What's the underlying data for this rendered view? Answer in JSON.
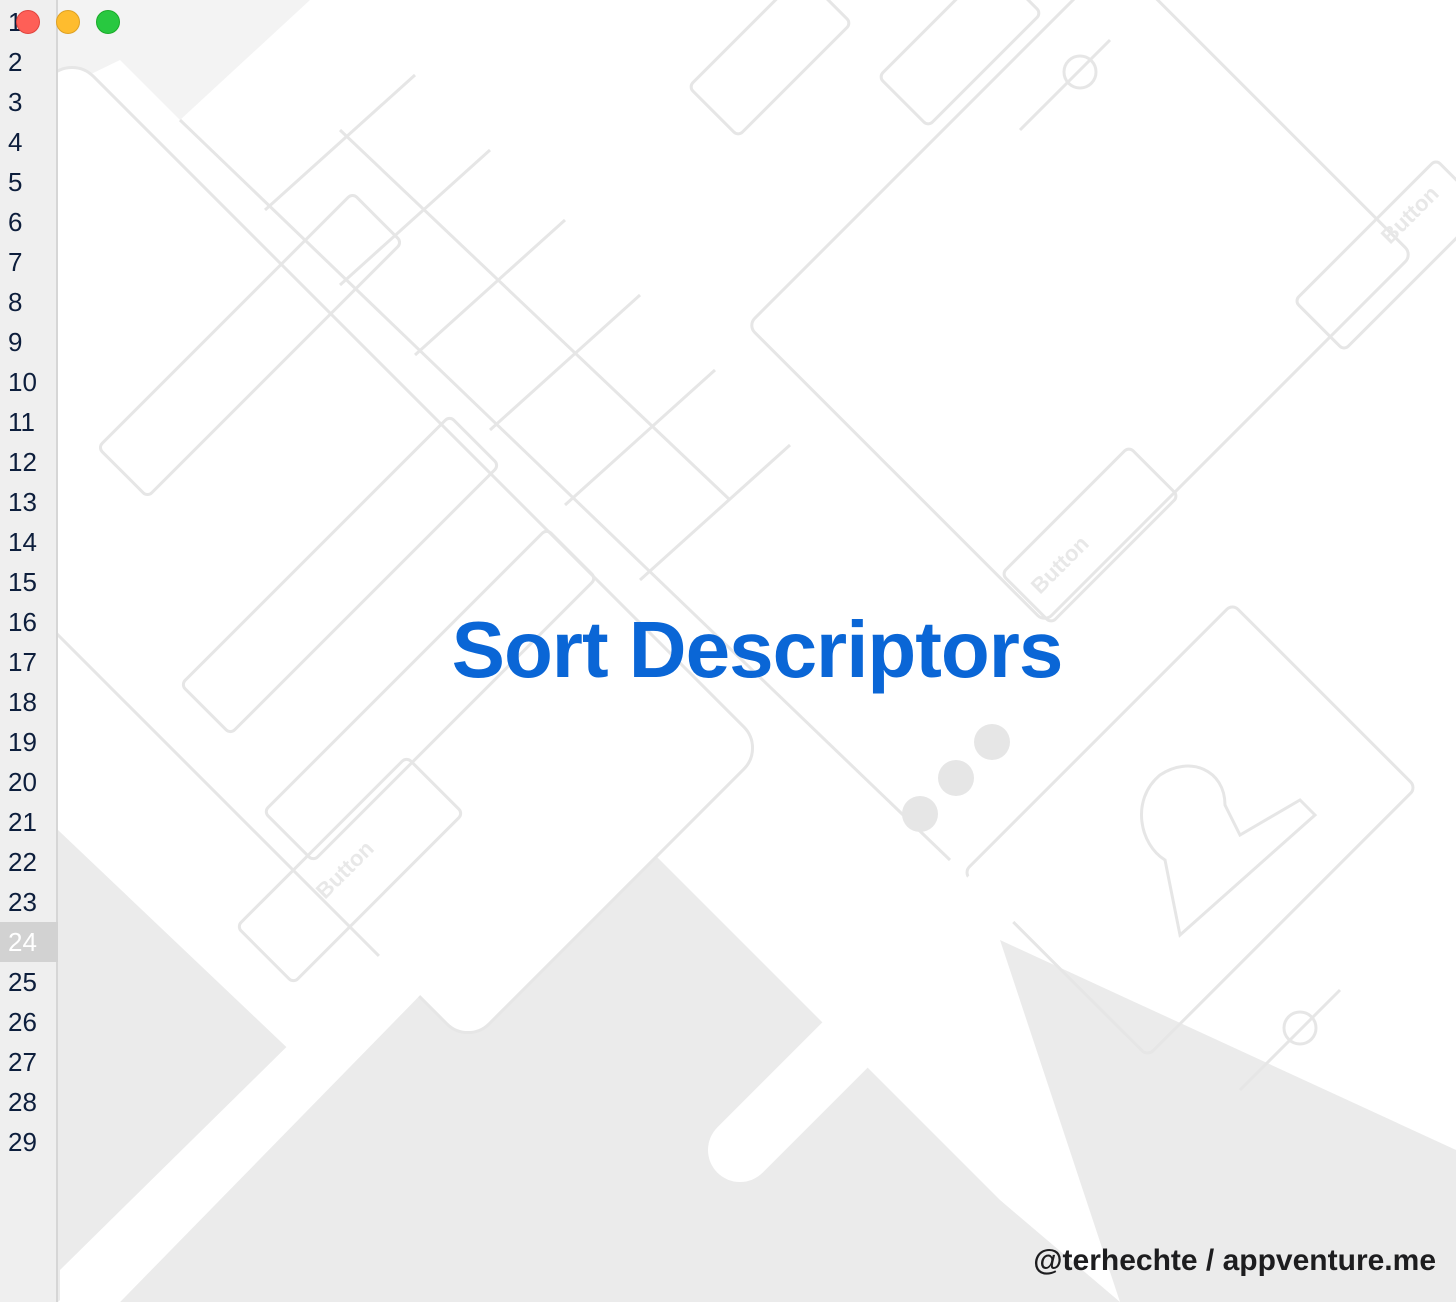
{
  "window": {
    "controls": {
      "close_icon": "close-icon",
      "minimize_icon": "minimize-icon",
      "zoom_icon": "zoom-icon"
    }
  },
  "gutter": {
    "lines": [
      "1",
      "2",
      "3",
      "4",
      "5",
      "6",
      "7",
      "8",
      "9",
      "10",
      "11",
      "12",
      "13",
      "14",
      "15",
      "16",
      "17",
      "18",
      "19",
      "20",
      "21",
      "22",
      "23",
      "24",
      "25",
      "26",
      "27",
      "28",
      "29"
    ],
    "current_line": "24"
  },
  "slide": {
    "title": "Sort Descriptors",
    "credit": "@terhechte / appventure.me",
    "background_labels": [
      "Button",
      "Button",
      "Button"
    ],
    "colors": {
      "title": "#0a66d6",
      "credit": "#1d1d1f",
      "background_tint": "#ebebeb"
    }
  }
}
